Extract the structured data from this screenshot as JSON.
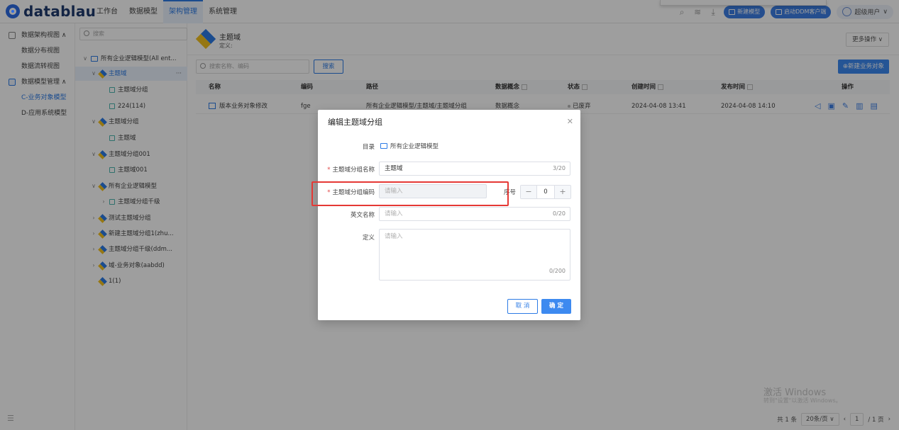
{
  "header": {
    "logo": "datablau",
    "nav": [
      "工作台",
      "数据模型",
      "架构管理",
      "系统管理"
    ],
    "active_nav": 2,
    "pills": [
      "新建模型",
      "启动DDM客户端"
    ],
    "user": "超级用户"
  },
  "side1": {
    "items": [
      {
        "label": "数据架构视图",
        "type": "group"
      },
      {
        "label": "数据分布视图",
        "type": "item"
      },
      {
        "label": "数据流转视图",
        "type": "item"
      },
      {
        "label": "数据模型管理",
        "type": "group"
      },
      {
        "label": "C-业务对象模型",
        "type": "item",
        "active": true
      },
      {
        "label": "D-应用系统模型",
        "type": "item"
      }
    ]
  },
  "tree": {
    "search_placeholder": "搜索",
    "nodes": [
      {
        "label": "所有企业逻辑模型(All ent...",
        "caret": "∨",
        "icon": "folder",
        "indent": 0
      },
      {
        "label": "主题域",
        "caret": "∨",
        "icon": "diamond",
        "indent": 1,
        "selected": true
      },
      {
        "label": "主题域分组",
        "caret": "",
        "icon": "entity",
        "indent": 2
      },
      {
        "label": "224(114)",
        "caret": "",
        "icon": "entity",
        "indent": 2
      },
      {
        "label": "主题域分组",
        "caret": "∨",
        "icon": "diamond",
        "indent": 1
      },
      {
        "label": "主题域",
        "caret": "",
        "icon": "entity",
        "indent": 2
      },
      {
        "label": "主题域分组001",
        "caret": "∨",
        "icon": "diamond",
        "indent": 1
      },
      {
        "label": "主题域001",
        "caret": "",
        "icon": "entity",
        "indent": 2
      },
      {
        "label": "所有企业逻辑模型",
        "caret": "∨",
        "icon": "diamond",
        "indent": 1
      },
      {
        "label": "主题域分组千级",
        "caret": "›",
        "icon": "entity",
        "indent": 2
      },
      {
        "label": "测试主题域分组",
        "caret": "›",
        "icon": "diamond",
        "indent": 1
      },
      {
        "label": "新建主题域分组1(zhu...",
        "caret": "›",
        "icon": "diamond",
        "indent": 1
      },
      {
        "label": "主题域分组千级(ddm...",
        "caret": "›",
        "icon": "diamond",
        "indent": 1
      },
      {
        "label": "域-业务对象(aabdd)",
        "caret": "›",
        "icon": "diamond",
        "indent": 1
      },
      {
        "label": "1(1)",
        "caret": "",
        "icon": "diamond",
        "indent": 1
      }
    ],
    "more": "···"
  },
  "main": {
    "title": "主题域",
    "definition": "定义:",
    "more_ops": "更多操作 ∨",
    "search_placeholder": "搜索名称、编码",
    "search_button": "搜索",
    "new_button": "⊕新建业务对象",
    "columns": [
      "名称",
      "编码",
      "路径",
      "数据概念",
      "状态",
      "创建时间",
      "发布时间",
      "操作"
    ],
    "row": {
      "name": "版本业务对象修改",
      "code": "fge",
      "path": "所有企业逻辑模型/主题域/主题域分组",
      "concept": "数据概念",
      "status": "已废弃",
      "created": "2024-04-08 13:41",
      "published": "2024-04-08 14:10"
    },
    "pager": {
      "total": "共 1 条",
      "size": "20条/页",
      "page": "1",
      "pages": "/ 1 页"
    }
  },
  "watermark": {
    "line1": "激活 Windows",
    "line2": "转到\"设置\"以激活 Windows。"
  },
  "dialog": {
    "title": "编辑主题域分组",
    "dir_label": "目录",
    "dir_value": "所有企业逻辑模型",
    "name_label": "主题域分组名称",
    "name_value": "主题域",
    "name_count": "3/20",
    "code_label": "主题域分组编码",
    "code_placeholder": "请输入",
    "order_label": "序号",
    "order_value": "0",
    "en_label": "英文名称",
    "en_placeholder": "请输入",
    "en_count": "0/20",
    "def_label": "定义",
    "def_placeholder": "请输入",
    "def_count": "0/200",
    "cancel": "取 消",
    "ok": "确 定"
  },
  "colors": {
    "accent": "#2d7be5",
    "highlight": "#e53935"
  }
}
